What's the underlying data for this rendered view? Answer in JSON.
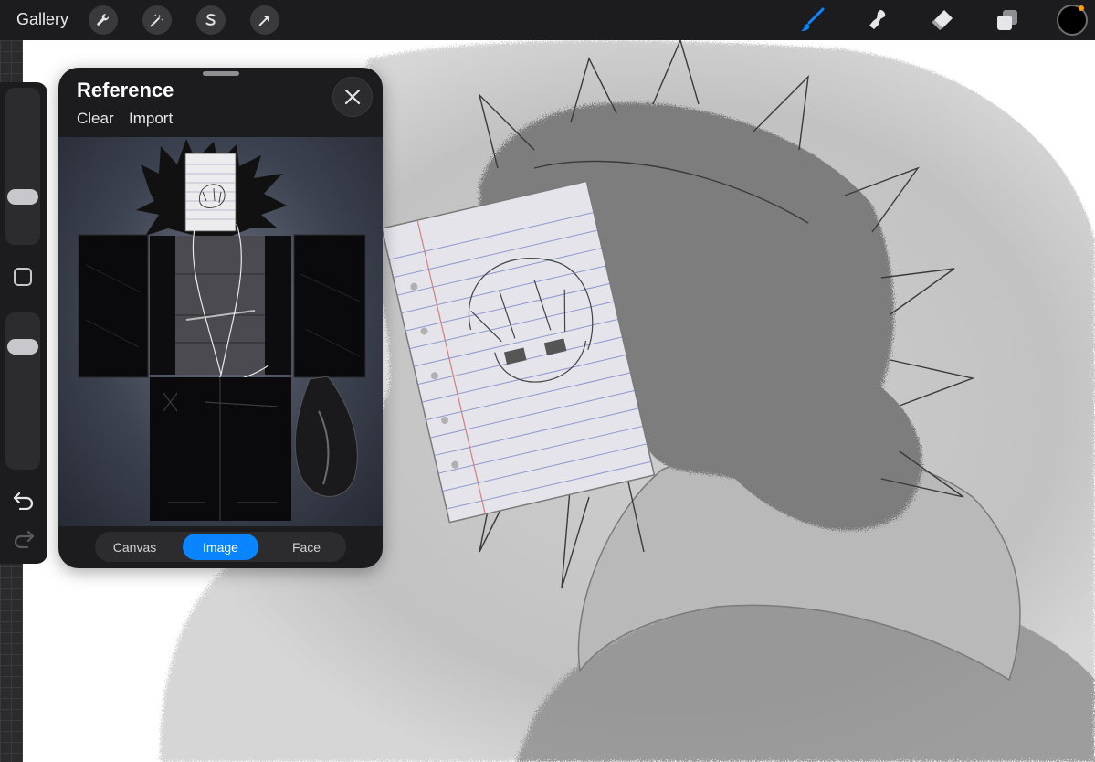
{
  "toolbar": {
    "gallery_label": "Gallery",
    "left_tools": [
      "wrench-icon",
      "magic-wand-icon",
      "selection-icon",
      "transform-arrow-icon"
    ],
    "right_tools": [
      "brush-icon",
      "smudge-icon",
      "eraser-icon",
      "layers-icon"
    ],
    "active_tool": "brush-icon",
    "current_color": "#000000",
    "accent_color": "#0a84ff"
  },
  "sidebar": {
    "brush_size_slider": {
      "level": 0.45
    },
    "opacity_slider": {
      "level": 0.8
    },
    "modify_button": "square-icon",
    "undo_icon": "undo-icon",
    "redo_icon": "redo-icon"
  },
  "reference": {
    "title": "Reference",
    "clear_label": "Clear",
    "import_label": "Import",
    "close_icon": "close-icon",
    "tabs": [
      {
        "label": "Canvas",
        "active": false
      },
      {
        "label": "Image",
        "active": true
      },
      {
        "label": "Face",
        "active": false
      }
    ]
  }
}
